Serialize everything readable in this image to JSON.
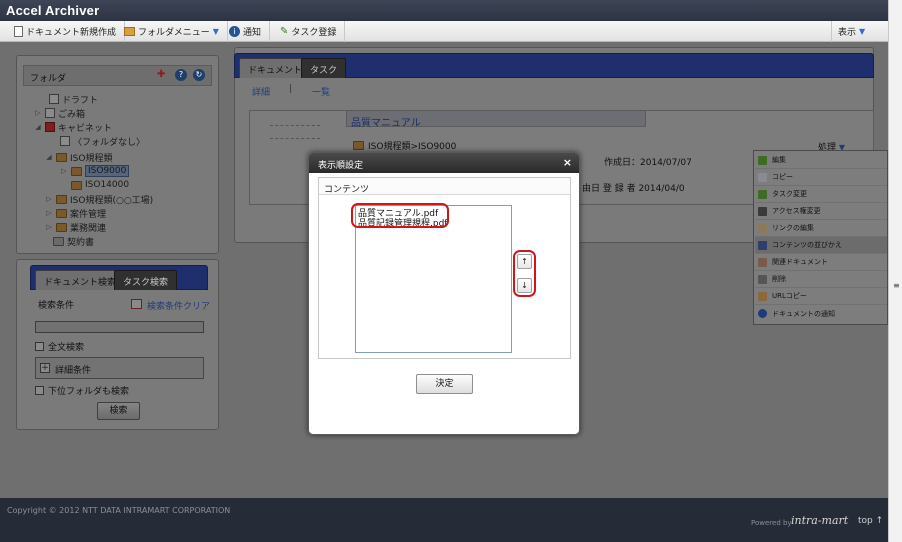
{
  "app": {
    "title": "Accel Archiver"
  },
  "toolbar": {
    "new_doc": "ドキュメント新規作成",
    "folder_menu": "フォルダメニュー",
    "notice": "通知",
    "task": "タスク登録",
    "display": "表示"
  },
  "folder_panel": {
    "title": "フォルダ",
    "tree": [
      {
        "label": "ドラフト",
        "icon": "draft-icon"
      },
      {
        "label": "ごみ箱",
        "icon": "trash-icon"
      },
      {
        "label": "キャビネット",
        "icon": "cabinet-icon"
      },
      {
        "label": "〈フォルダなし〉",
        "icon": "folder-none-icon"
      },
      {
        "label": "ISO規程類",
        "icon": "folder-icon"
      },
      {
        "label": "ISO9000",
        "icon": "folder-icon"
      },
      {
        "label": "ISO14000",
        "icon": "folder-icon"
      },
      {
        "label": "ISO規程類(○○工場)",
        "icon": "folder-icon"
      },
      {
        "label": "案件管理",
        "icon": "folder-icon"
      },
      {
        "label": "業務関連",
        "icon": "folder-icon"
      },
      {
        "label": "契約書",
        "icon": "contract-icon"
      }
    ]
  },
  "search_panel": {
    "tabs": [
      "ドキュメント検索",
      "タスク検索"
    ],
    "condition_label": "検索条件",
    "clear_label": "検索条件クリア",
    "fulltext_label": "全文検索",
    "detail_label": "詳細条件",
    "subfolder_label": "下位フォルダも検索",
    "search_button": "検索"
  },
  "main_panel": {
    "tabs": [
      "ドキュメント",
      "タスク"
    ],
    "view_links": [
      "詳細",
      "一覧"
    ],
    "doc_title": "品質マニュアル",
    "doc_path": "ISO規程類>ISO9000",
    "action_label": "処理",
    "created": "作成日：2014/07/07",
    "registered": "由日 登 録 者 2014/04/0"
  },
  "context_menu": {
    "items": [
      {
        "label": "編集",
        "color": "#4a7a2a"
      },
      {
        "label": "コピー",
        "color": "#7a7a8a"
      },
      {
        "label": "タスク変更",
        "color": "#4a7a2a"
      },
      {
        "label": "アクセス権変更",
        "color": "#444"
      },
      {
        "label": "リンクの編集",
        "color": "#7a6a4a"
      },
      {
        "label": "コンテンツの並びかえ",
        "color": "#3a4a7a"
      },
      {
        "label": "関連ドキュメント",
        "color": "#7a5a4a"
      },
      {
        "label": "削除",
        "color": "#555"
      },
      {
        "label": "URLコピー",
        "color": "#7a5a3a"
      },
      {
        "label": "ドキュメントの通知",
        "color": "#2a4a8a"
      }
    ]
  },
  "dialog": {
    "title": "表示順設定",
    "close_label": "×",
    "section_title": "コンテンツ",
    "items": [
      "品質マニュアル.pdf",
      "品質記録管理規程.pdf"
    ],
    "up_label": "↑",
    "down_label": "↓",
    "ok_label": "決定"
  },
  "footer": {
    "copyright": "Copyright © 2012 NTT DATA INTRAMART CORPORATION",
    "powered": "Powered by",
    "brand": "intra-mart",
    "top": "top ↑"
  },
  "scrollbar": {
    "mark": "≡"
  }
}
